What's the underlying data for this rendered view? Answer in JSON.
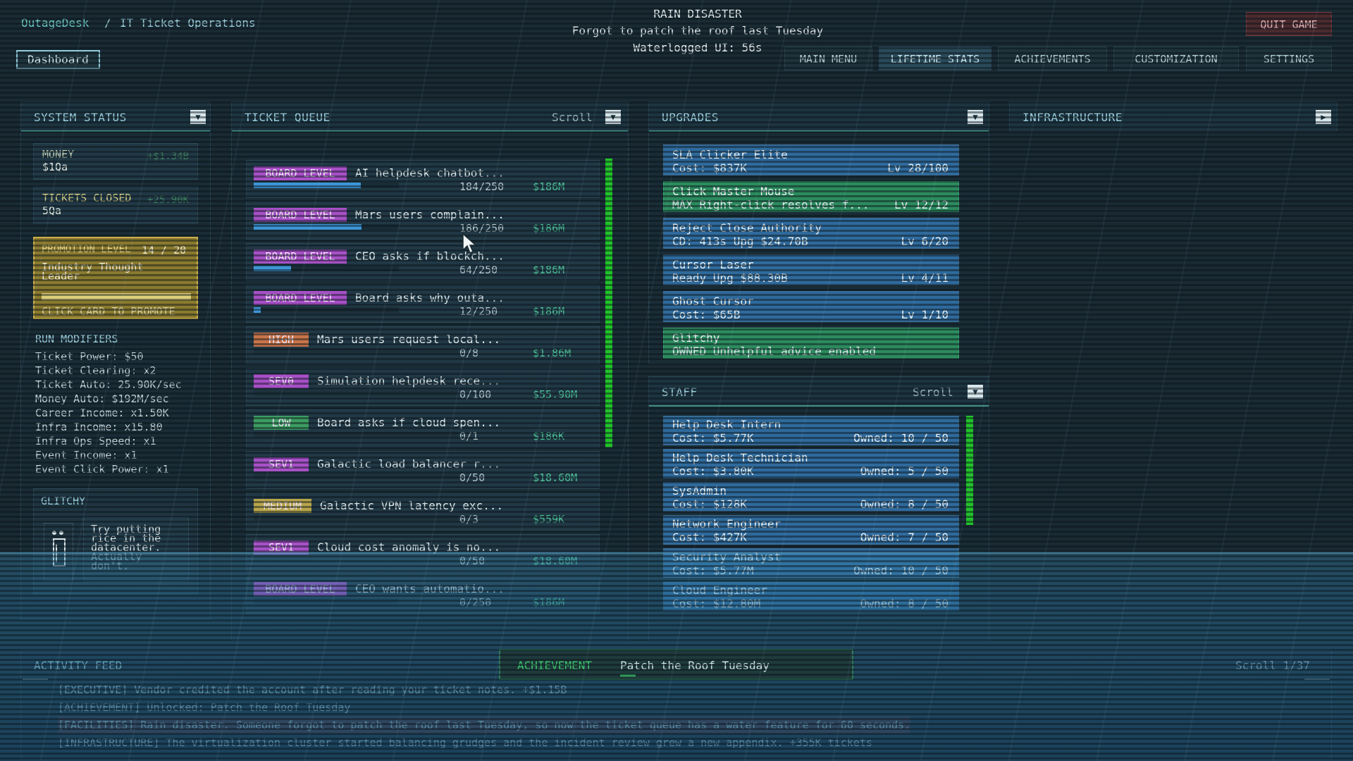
{
  "header": {
    "app_name": "OutageDesk",
    "separator": "/",
    "section": "IT Ticket Operations",
    "dashboard_button": "Dashboard",
    "event": {
      "title": "RAIN DISASTER",
      "subtitle": "Forgot to patch the roof last Tuesday",
      "timer": "Waterlogged UI: 56s"
    },
    "nav": [
      "MAIN MENU",
      "LIFETIME STATS",
      "ACHIEVEMENTS",
      "CUSTOMIZATION",
      "SETTINGS"
    ],
    "quit": "QUIT GAME"
  },
  "system_status": {
    "title": "SYSTEM STATUS",
    "money": {
      "label": "MONEY",
      "value": "$1Qa",
      "delta": "+$1.34B"
    },
    "tickets_closed": {
      "label": "TICKETS CLOSED",
      "value": "5Qa",
      "delta": "+25.90K"
    },
    "promotion": {
      "label": "PROMOTION LEVEL",
      "level": "14 / 20",
      "rank_line1": "Industry Thought",
      "rank_line2": "Leader",
      "progress": 1.0,
      "cta": "CLICK CARD TO PROMOTE"
    },
    "run_modifiers_title": "RUN MODIFIERS",
    "run_modifiers": [
      "Ticket Power: $50",
      "Ticket Clearing: x2",
      "Ticket Auto: 25.90K/sec",
      "Money Auto: $192M/sec",
      "Career Income: x1.50K",
      "Infra Income: x15.80",
      "Infra Ops Speed: x1",
      "Event Income: x1",
      "Event Click Power: x1"
    ],
    "glitchy": {
      "title": "GLITCHY",
      "line1": "Try putting",
      "line2": "rice in the",
      "line3": "datacenter.",
      "line4": "Actually",
      "line5": "don't."
    }
  },
  "ticket_queue": {
    "title": "TICKET QUEUE",
    "scroll_label": "Scroll",
    "tickets": [
      {
        "tag": "BOARD LEVEL",
        "kind": "board",
        "title": "AI helpdesk chatbot...",
        "progress": "184/250",
        "fill": 0.736,
        "money": "$186M"
      },
      {
        "tag": "BOARD LEVEL",
        "kind": "board",
        "title": "Mars users complain...",
        "progress": "186/250",
        "fill": 0.744,
        "money": "$186M"
      },
      {
        "tag": "BOARD LEVEL",
        "kind": "board",
        "title": "CEO asks if blockch...",
        "progress": "64/250",
        "fill": 0.256,
        "money": "$186M"
      },
      {
        "tag": "BOARD LEVEL",
        "kind": "board",
        "title": "Board asks why outa...",
        "progress": "12/250",
        "fill": 0.048,
        "money": "$186M"
      },
      {
        "tag": "HIGH",
        "kind": "high",
        "title": "Mars users request local...",
        "progress": "0/8",
        "fill": 0,
        "money": "$1.86M"
      },
      {
        "tag": "SEV0",
        "kind": "sev",
        "title": "Simulation helpdesk rece...",
        "progress": "0/100",
        "fill": 0,
        "money": "$55.90M"
      },
      {
        "tag": "LOW",
        "kind": "low",
        "title": "Board asks if cloud spen...",
        "progress": "0/1",
        "fill": 0,
        "money": "$186K"
      },
      {
        "tag": "SEV1",
        "kind": "sev",
        "title": "Galactic load balancer r...",
        "progress": "0/50",
        "fill": 0,
        "money": "$18.60M"
      },
      {
        "tag": "MEDIUM",
        "kind": "med",
        "title": "Galactic VPN latency exc...",
        "progress": "0/3",
        "fill": 0,
        "money": "$559K"
      },
      {
        "tag": "SEV1",
        "kind": "sev",
        "title": "Cloud cost anomaly is no...",
        "progress": "0/50",
        "fill": 0,
        "money": "$18.60M"
      },
      {
        "tag": "BOARD LEVEL",
        "kind": "board",
        "title": "CEO wants automatio...",
        "progress": "0/250",
        "fill": 0,
        "money": "$186M"
      }
    ]
  },
  "upgrades": {
    "title": "UPGRADES",
    "items": [
      {
        "name": "SLA Clicker Elite",
        "sub": "Cost: $837K",
        "right": "Lv 28/100",
        "color": "blue"
      },
      {
        "name": "Click Master Mouse",
        "sub": "MAX  Right-click resolves f...",
        "right": "Lv 12/12",
        "color": "green"
      },
      {
        "name": "Reject Close Authority",
        "sub": "CD: 413s  Upg $24.70B",
        "right": "Lv 6/20",
        "color": "blue"
      },
      {
        "name": "Cursor Laser",
        "sub": "Ready  Upg $88.30B",
        "right": "Lv 4/11",
        "color": "blue"
      },
      {
        "name": "Ghost Cursor",
        "sub": "Cost: $65B",
        "right": "Lv 1/10",
        "color": "blue"
      },
      {
        "name": "Glitchy",
        "sub": "OWNED  Unhelpful advice enabled",
        "right": "",
        "color": "green"
      }
    ]
  },
  "staff": {
    "title": "STAFF",
    "scroll_label": "Scroll",
    "items": [
      {
        "name": "Help Desk Intern",
        "sub": "Cost: $5.77K",
        "right": "Owned: 10 / 50"
      },
      {
        "name": "Help Desk Technician",
        "sub": "Cost: $3.80K",
        "right": "Owned: 5 / 50"
      },
      {
        "name": "SysAdmin",
        "sub": "Cost: $128K",
        "right": "Owned: 8 / 50"
      },
      {
        "name": "Network Engineer",
        "sub": "Cost: $427K",
        "right": "Owned: 7 / 50"
      },
      {
        "name": "Security Analyst",
        "sub": "Cost: $5.77M",
        "right": "Owned: 10 / 50"
      },
      {
        "name": "Cloud Engineer",
        "sub": "Cost: $12.80M",
        "right": "Owned: 8 / 50"
      }
    ]
  },
  "infrastructure": {
    "title": "INFRASTRUCTURE"
  },
  "activity_feed": {
    "title": "ACTIVITY FEED",
    "scroll_label": "Scroll 1/37",
    "toast": {
      "label": "ACHIEVEMENT",
      "text": "Patch the Roof Tuesday"
    },
    "lines": [
      "[EXECUTIVE] Vendor credited the account after reading your ticket notes. +$1.15B",
      "[ACHIEVEMENT] Unlocked: Patch the Roof Tuesday",
      "[FACILITIES] Rain disaster. Someone forgot to patch the roof last Tuesday, so now the ticket queue has a water feature for 60 seconds.",
      "[INFRASTRUCTURE] The virtualization cluster started balancing grudges and the incident review grew a new appendix. +355K tickets"
    ]
  },
  "colors": {
    "background": "#1a2a33",
    "accent_teal": "#3f8f85",
    "promo_gold": "#8a7a2e",
    "upgrade_blue": "#2f6a9c",
    "upgrade_green": "#2c8b5e",
    "money_green": "#4ec59a",
    "scrollbar_green": "#22c22a",
    "quit_red": "#4a2a2e"
  }
}
